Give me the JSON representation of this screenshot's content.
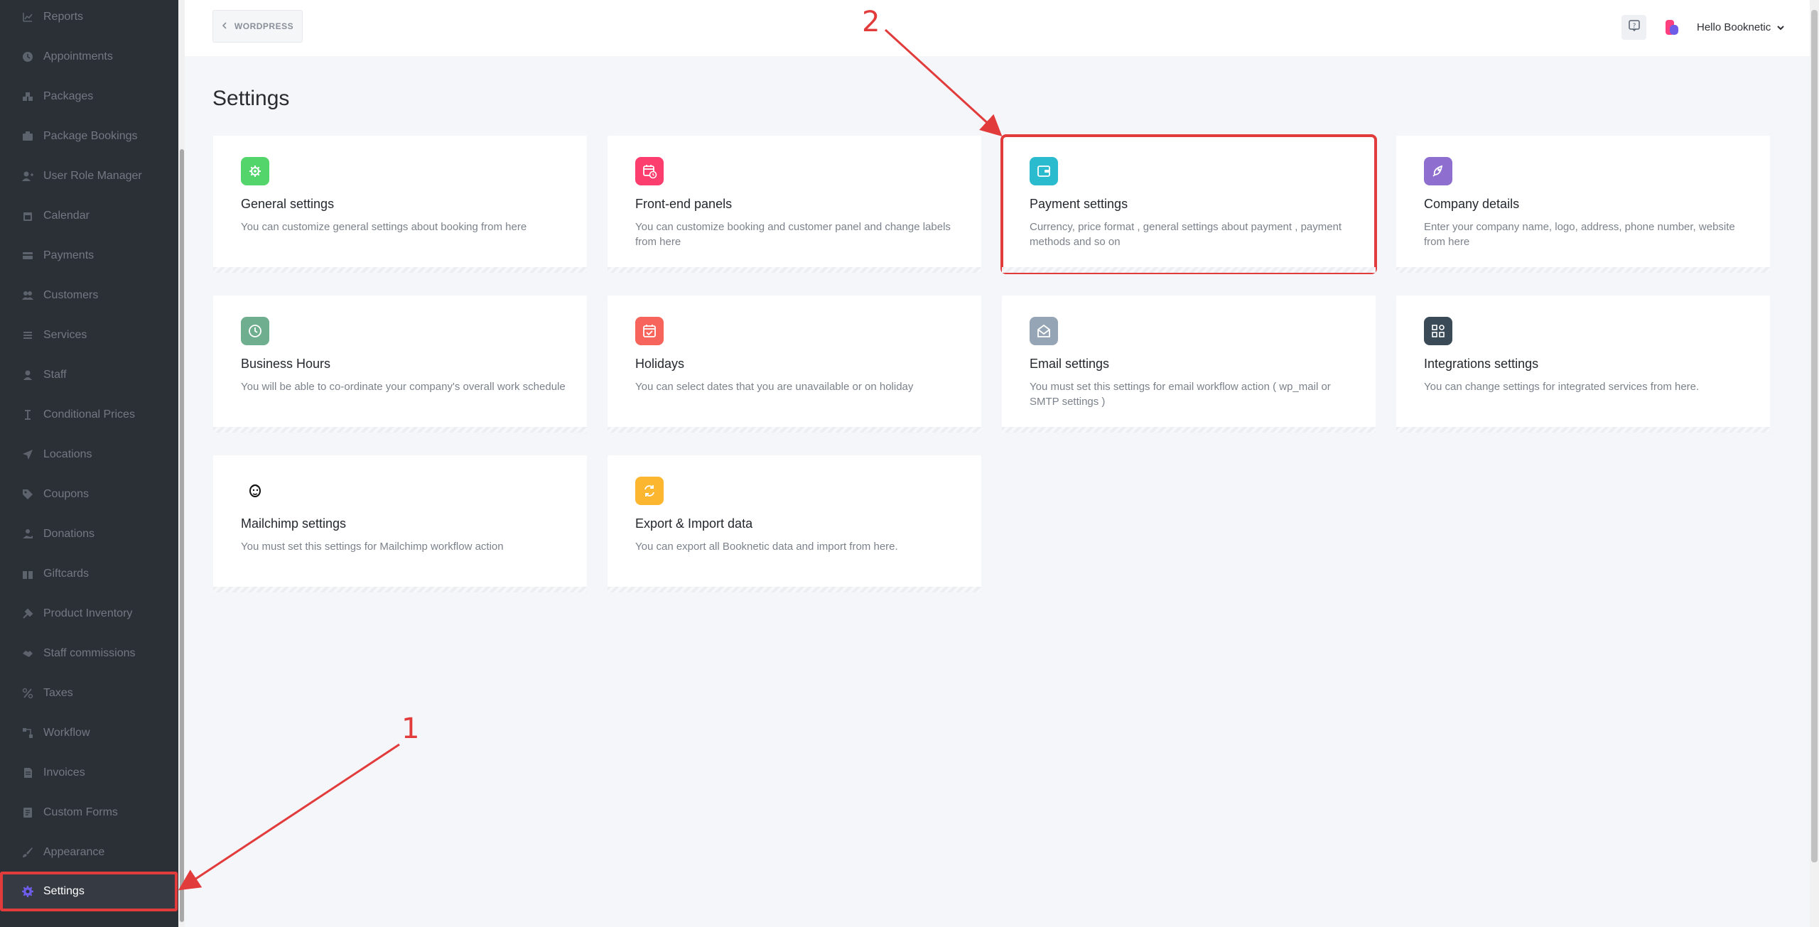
{
  "sidebar": {
    "items": [
      {
        "label": "Reports",
        "icon": "chart-icon"
      },
      {
        "label": "Appointments",
        "icon": "clock-icon"
      },
      {
        "label": "Packages",
        "icon": "packages-icon"
      },
      {
        "label": "Package Bookings",
        "icon": "package-bookings-icon"
      },
      {
        "label": "User Role Manager",
        "icon": "user-role-icon"
      },
      {
        "label": "Calendar",
        "icon": "calendar-icon"
      },
      {
        "label": "Payments",
        "icon": "payments-icon"
      },
      {
        "label": "Customers",
        "icon": "customers-icon"
      },
      {
        "label": "Services",
        "icon": "services-icon"
      },
      {
        "label": "Staff",
        "icon": "staff-icon"
      },
      {
        "label": "Conditional Prices",
        "icon": "conditional-prices-icon"
      },
      {
        "label": "Locations",
        "icon": "location-arrow-icon"
      },
      {
        "label": "Coupons",
        "icon": "tag-icon"
      },
      {
        "label": "Donations",
        "icon": "donations-icon"
      },
      {
        "label": "Giftcards",
        "icon": "gift-icon"
      },
      {
        "label": "Product Inventory",
        "icon": "inventory-icon"
      },
      {
        "label": "Staff commissions",
        "icon": "handshake-icon"
      },
      {
        "label": "Taxes",
        "icon": "percent-icon"
      },
      {
        "label": "Workflow",
        "icon": "workflow-icon"
      },
      {
        "label": "Invoices",
        "icon": "invoice-icon"
      },
      {
        "label": "Custom Forms",
        "icon": "forms-icon"
      },
      {
        "label": "Appearance",
        "icon": "brush-icon"
      },
      {
        "label": "Settings",
        "icon": "gear-icon",
        "active": true
      }
    ]
  },
  "header": {
    "wordpress_label": "WORDPRESS",
    "user_greeting": "Hello Booknetic"
  },
  "main": {
    "title": "Settings",
    "cards": [
      {
        "title": "General settings",
        "desc": "You can customize general settings about booking from here",
        "icon": "gear-icon",
        "color": "#53d56c"
      },
      {
        "title": "Front-end panels",
        "desc": "You can customize booking and customer panel and change labels from here",
        "icon": "calendar-clock-icon",
        "color": "#fb3e6e"
      },
      {
        "title": "Payment settings",
        "desc": "Currency, price format , general settings about payment , payment methods and so on",
        "icon": "wallet-icon",
        "color": "#2bbbce"
      },
      {
        "title": "Company details",
        "desc": "Enter your company name, logo, address, phone number, website from here",
        "icon": "rocket-icon",
        "color": "#8e6fcf"
      },
      {
        "title": "Business Hours",
        "desc": "You will be able to co-ordinate your company's overall work schedule",
        "icon": "clock-icon",
        "color": "#6fae8f"
      },
      {
        "title": "Holidays",
        "desc": "You can select dates that you are unavailable or on holiday",
        "icon": "calendar-check-icon",
        "color": "#f6645c"
      },
      {
        "title": "Email settings",
        "desc": "You must set this settings for email workflow action ( wp_mail or SMTP settings )",
        "icon": "envelope-open-icon",
        "color": "#95a5b5"
      },
      {
        "title": "Integrations settings",
        "desc": "You can change settings for integrated services from here.",
        "icon": "puzzle-grid-icon",
        "color": "#3a4b57"
      },
      {
        "title": "Mailchimp settings",
        "desc": "You must set this settings for Mailchimp workflow action",
        "icon": "mailchimp-icon",
        "color": "#ffffff"
      },
      {
        "title": "Export & Import data",
        "desc": "You can export all Booknetic data and import from here.",
        "icon": "sync-icon",
        "color": "#fdb62f"
      }
    ]
  },
  "annotations": {
    "marker_1": "1",
    "marker_2": "2",
    "color": "#e13b3b"
  }
}
